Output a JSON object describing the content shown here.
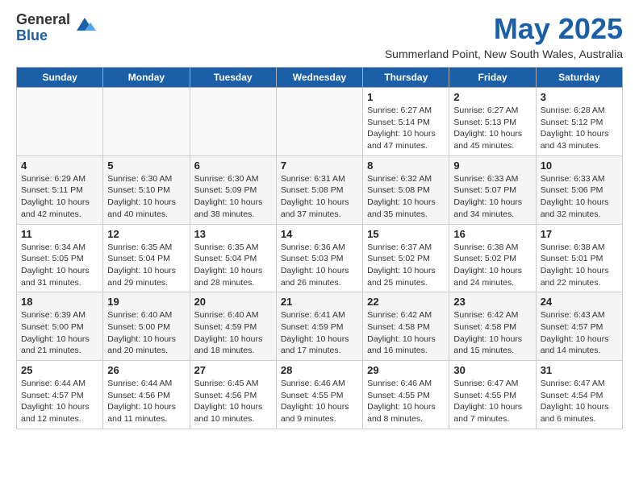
{
  "header": {
    "logo_general": "General",
    "logo_blue": "Blue",
    "main_title": "May 2025",
    "subtitle": "Summerland Point, New South Wales, Australia"
  },
  "days": [
    "Sunday",
    "Monday",
    "Tuesday",
    "Wednesday",
    "Thursday",
    "Friday",
    "Saturday"
  ],
  "weeks": [
    [
      {
        "date": "",
        "info": ""
      },
      {
        "date": "",
        "info": ""
      },
      {
        "date": "",
        "info": ""
      },
      {
        "date": "",
        "info": ""
      },
      {
        "date": "1",
        "info": "Sunrise: 6:27 AM\nSunset: 5:14 PM\nDaylight: 10 hours\nand 47 minutes."
      },
      {
        "date": "2",
        "info": "Sunrise: 6:27 AM\nSunset: 5:13 PM\nDaylight: 10 hours\nand 45 minutes."
      },
      {
        "date": "3",
        "info": "Sunrise: 6:28 AM\nSunset: 5:12 PM\nDaylight: 10 hours\nand 43 minutes."
      }
    ],
    [
      {
        "date": "4",
        "info": "Sunrise: 6:29 AM\nSunset: 5:11 PM\nDaylight: 10 hours\nand 42 minutes."
      },
      {
        "date": "5",
        "info": "Sunrise: 6:30 AM\nSunset: 5:10 PM\nDaylight: 10 hours\nand 40 minutes."
      },
      {
        "date": "6",
        "info": "Sunrise: 6:30 AM\nSunset: 5:09 PM\nDaylight: 10 hours\nand 38 minutes."
      },
      {
        "date": "7",
        "info": "Sunrise: 6:31 AM\nSunset: 5:08 PM\nDaylight: 10 hours\nand 37 minutes."
      },
      {
        "date": "8",
        "info": "Sunrise: 6:32 AM\nSunset: 5:08 PM\nDaylight: 10 hours\nand 35 minutes."
      },
      {
        "date": "9",
        "info": "Sunrise: 6:33 AM\nSunset: 5:07 PM\nDaylight: 10 hours\nand 34 minutes."
      },
      {
        "date": "10",
        "info": "Sunrise: 6:33 AM\nSunset: 5:06 PM\nDaylight: 10 hours\nand 32 minutes."
      }
    ],
    [
      {
        "date": "11",
        "info": "Sunrise: 6:34 AM\nSunset: 5:05 PM\nDaylight: 10 hours\nand 31 minutes."
      },
      {
        "date": "12",
        "info": "Sunrise: 6:35 AM\nSunset: 5:04 PM\nDaylight: 10 hours\nand 29 minutes."
      },
      {
        "date": "13",
        "info": "Sunrise: 6:35 AM\nSunset: 5:04 PM\nDaylight: 10 hours\nand 28 minutes."
      },
      {
        "date": "14",
        "info": "Sunrise: 6:36 AM\nSunset: 5:03 PM\nDaylight: 10 hours\nand 26 minutes."
      },
      {
        "date": "15",
        "info": "Sunrise: 6:37 AM\nSunset: 5:02 PM\nDaylight: 10 hours\nand 25 minutes."
      },
      {
        "date": "16",
        "info": "Sunrise: 6:38 AM\nSunset: 5:02 PM\nDaylight: 10 hours\nand 24 minutes."
      },
      {
        "date": "17",
        "info": "Sunrise: 6:38 AM\nSunset: 5:01 PM\nDaylight: 10 hours\nand 22 minutes."
      }
    ],
    [
      {
        "date": "18",
        "info": "Sunrise: 6:39 AM\nSunset: 5:00 PM\nDaylight: 10 hours\nand 21 minutes."
      },
      {
        "date": "19",
        "info": "Sunrise: 6:40 AM\nSunset: 5:00 PM\nDaylight: 10 hours\nand 20 minutes."
      },
      {
        "date": "20",
        "info": "Sunrise: 6:40 AM\nSunset: 4:59 PM\nDaylight: 10 hours\nand 18 minutes."
      },
      {
        "date": "21",
        "info": "Sunrise: 6:41 AM\nSunset: 4:59 PM\nDaylight: 10 hours\nand 17 minutes."
      },
      {
        "date": "22",
        "info": "Sunrise: 6:42 AM\nSunset: 4:58 PM\nDaylight: 10 hours\nand 16 minutes."
      },
      {
        "date": "23",
        "info": "Sunrise: 6:42 AM\nSunset: 4:58 PM\nDaylight: 10 hours\nand 15 minutes."
      },
      {
        "date": "24",
        "info": "Sunrise: 6:43 AM\nSunset: 4:57 PM\nDaylight: 10 hours\nand 14 minutes."
      }
    ],
    [
      {
        "date": "25",
        "info": "Sunrise: 6:44 AM\nSunset: 4:57 PM\nDaylight: 10 hours\nand 12 minutes."
      },
      {
        "date": "26",
        "info": "Sunrise: 6:44 AM\nSunset: 4:56 PM\nDaylight: 10 hours\nand 11 minutes."
      },
      {
        "date": "27",
        "info": "Sunrise: 6:45 AM\nSunset: 4:56 PM\nDaylight: 10 hours\nand 10 minutes."
      },
      {
        "date": "28",
        "info": "Sunrise: 6:46 AM\nSunset: 4:55 PM\nDaylight: 10 hours\nand 9 minutes."
      },
      {
        "date": "29",
        "info": "Sunrise: 6:46 AM\nSunset: 4:55 PM\nDaylight: 10 hours\nand 8 minutes."
      },
      {
        "date": "30",
        "info": "Sunrise: 6:47 AM\nSunset: 4:55 PM\nDaylight: 10 hours\nand 7 minutes."
      },
      {
        "date": "31",
        "info": "Sunrise: 6:47 AM\nSunset: 4:54 PM\nDaylight: 10 hours\nand 6 minutes."
      }
    ]
  ]
}
